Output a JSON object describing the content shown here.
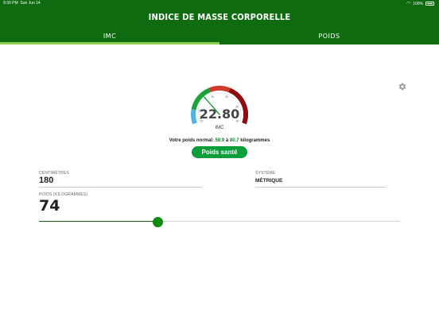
{
  "status_bar": {
    "time": "9:30 PM",
    "date": "Sun Jun 14",
    "battery": "100%"
  },
  "header": {
    "title": "INDICE DE MASSE CORPORELLE"
  },
  "tabs": [
    {
      "label": "IMC",
      "active": true
    },
    {
      "label": "POIDS",
      "active": false
    }
  ],
  "gauge": {
    "value": "22.80",
    "label": "IMC",
    "value_numeric": 22.8,
    "min": 15,
    "max": 40,
    "tick_labels": [
      "15",
      "16",
      "18.5",
      "25",
      "30",
      "35",
      "40"
    ],
    "colors": {
      "underweight": "#4fb3e8",
      "normal": "#1aa33a",
      "overweight": "#d23b2b",
      "obese": "#8b0f0f",
      "needle": "#1aa33a"
    }
  },
  "normal_weight": {
    "prefix": "Votre poids normal:",
    "min": "59.9",
    "sep": "à",
    "max": "80.7",
    "unit": "kilogrammes"
  },
  "status_badge": {
    "label": "Poids santé",
    "color": "#0b9e3a"
  },
  "height": {
    "label": "CENTIMÈTRES",
    "value": "180"
  },
  "system": {
    "label": "SYSTÈME",
    "value": "MÉTRIQUE"
  },
  "weight": {
    "label": "POIDS (KILOGRAMMES)",
    "value": "74",
    "slider_fraction": 0.33
  },
  "colors": {
    "header": "#0f6b0f",
    "tab_indicator": "#8ad04d",
    "accent": "#0f8a12"
  }
}
